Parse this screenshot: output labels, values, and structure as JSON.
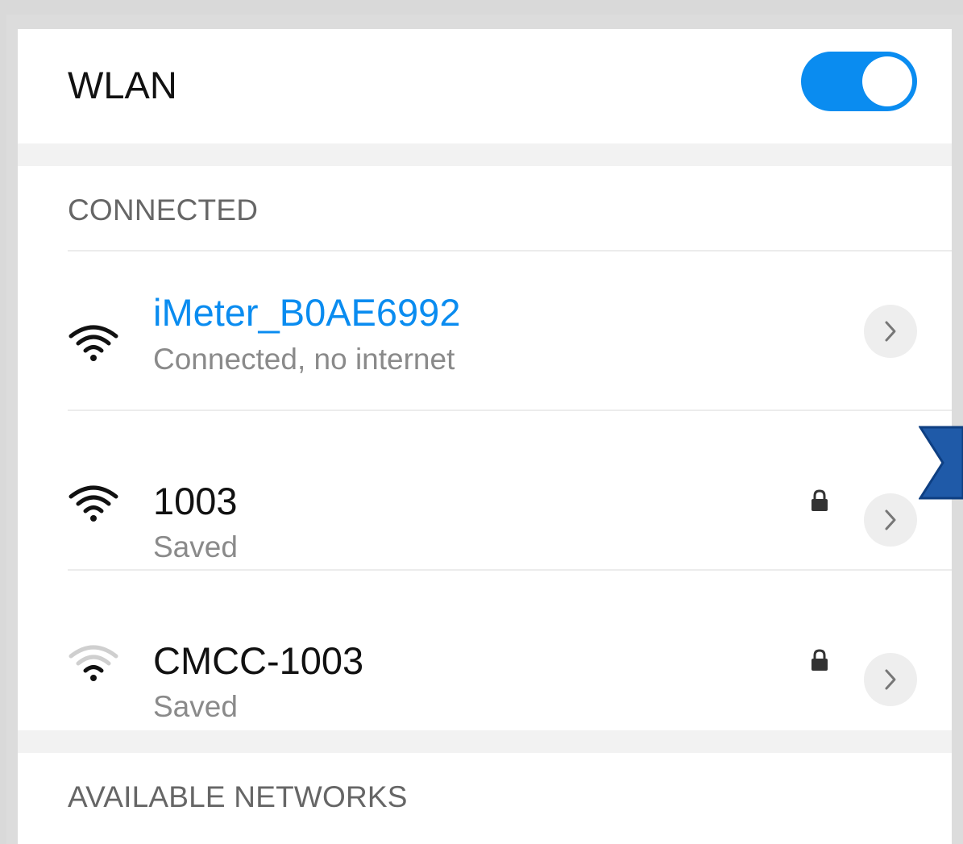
{
  "wlan": {
    "title": "WLAN",
    "enabled": true,
    "accent_color": "#0a8cf0"
  },
  "connected_section": {
    "heading": "CONNECTED",
    "networks": [
      {
        "name": "iMeter_B0AE6992",
        "status": "Connected, no internet",
        "secured": false,
        "signal": "strong",
        "connected": true
      },
      {
        "name": "1003",
        "status": "Saved",
        "secured": true,
        "signal": "strong",
        "connected": false
      },
      {
        "name": "CMCC-1003",
        "status": "Saved",
        "secured": true,
        "signal": "weak",
        "connected": false
      }
    ]
  },
  "available_section": {
    "heading": "AVAILABLE NETWORKS"
  },
  "icons": {
    "wifi": "wifi-signal-icon",
    "lock": "lock-icon",
    "chevron": "chevron-right-icon",
    "marker": "pointer-marker-icon"
  }
}
